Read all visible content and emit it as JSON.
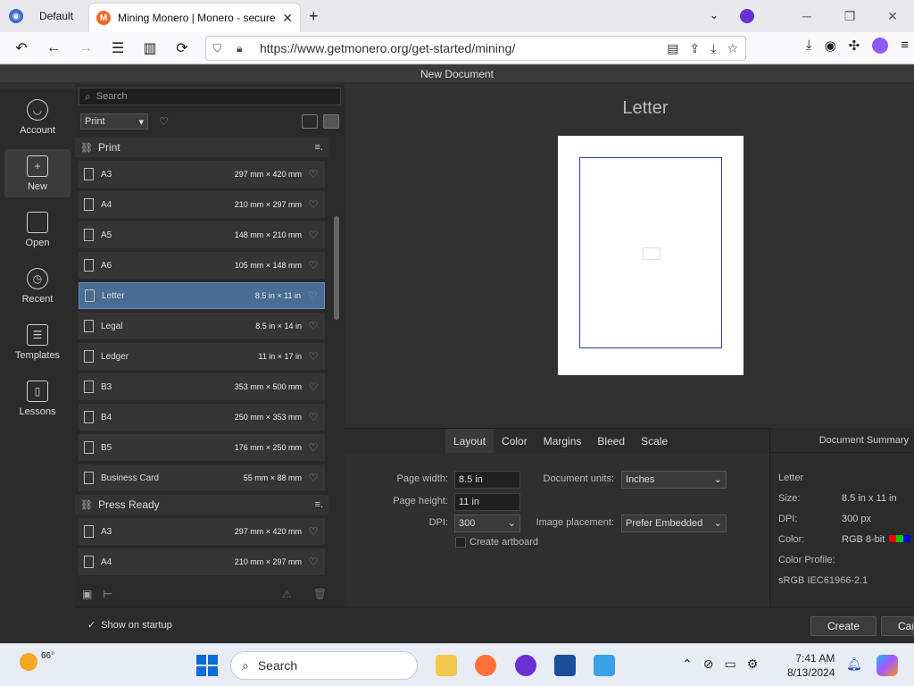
{
  "browser": {
    "profile_label": "Default",
    "tab_title": "Mining Monero | Monero - secure",
    "url": "https://www.getmonero.org/get-started/mining/"
  },
  "app": {
    "window_title": "New Document",
    "left_nav": [
      {
        "label": "Account",
        "icon": "account-icon"
      },
      {
        "label": "New",
        "icon": "new-document-icon",
        "active": true
      },
      {
        "label": "Open",
        "icon": "folder-icon"
      },
      {
        "label": "Recent",
        "icon": "clock-icon"
      },
      {
        "label": "Templates",
        "icon": "templates-icon"
      },
      {
        "label": "Lessons",
        "icon": "book-icon"
      }
    ],
    "search_placeholder": "Search",
    "filter_value": "Print",
    "sections": [
      {
        "title": "Print",
        "presets": [
          {
            "name": "A3",
            "size": "297 mm × 420 mm"
          },
          {
            "name": "A4",
            "size": "210 mm × 297 mm"
          },
          {
            "name": "A5",
            "size": "148 mm × 210 mm"
          },
          {
            "name": "A6",
            "size": "105 mm × 148 mm"
          },
          {
            "name": "Letter",
            "size": "8.5 in × 11 in",
            "selected": true
          },
          {
            "name": "Legal",
            "size": "8.5 in × 14 in"
          },
          {
            "name": "Ledger",
            "size": "11 in × 17 in"
          },
          {
            "name": "B3",
            "size": "353 mm × 500 mm"
          },
          {
            "name": "B4",
            "size": "250 mm × 353 mm"
          },
          {
            "name": "B5",
            "size": "176 mm × 250 mm"
          },
          {
            "name": "Business Card",
            "size": "55 mm × 88 mm"
          }
        ]
      },
      {
        "title": "Press Ready",
        "presets": [
          {
            "name": "A3",
            "size": "297 mm × 420 mm"
          },
          {
            "name": "A4",
            "size": "210 mm × 297 mm"
          }
        ]
      }
    ],
    "preview_title": "Letter",
    "tabs": [
      "Layout",
      "Color",
      "Margins",
      "Bleed",
      "Scale"
    ],
    "active_tab": "Layout",
    "layout": {
      "page_width_label": "Page width:",
      "page_width": "8.5 in",
      "page_height_label": "Page height:",
      "page_height": "11 in",
      "dpi_label": "DPI:",
      "dpi": "300",
      "doc_units_label": "Document units:",
      "doc_units": "Inches",
      "image_placement_label": "Image placement:",
      "image_placement": "Prefer Embedded",
      "create_artboard_label": "Create artboard"
    },
    "summary": {
      "header": "Document Summary",
      "name": "Letter",
      "size_label": "Size:",
      "size": "8.5 in  x  11 in",
      "dpi_label": "DPI:",
      "dpi": "300 px",
      "color_label": "Color:",
      "color": "RGB 8-bit",
      "profile_label": "Color Profile:",
      "profile": "sRGB IEC61966-2.1"
    },
    "show_on_startup": "Show on startup",
    "create_label": "Create",
    "cancel_label": "Car"
  },
  "taskbar": {
    "temperature": "66°",
    "search_label": "Search",
    "time": "7:41 AM",
    "date": "8/13/2024"
  }
}
